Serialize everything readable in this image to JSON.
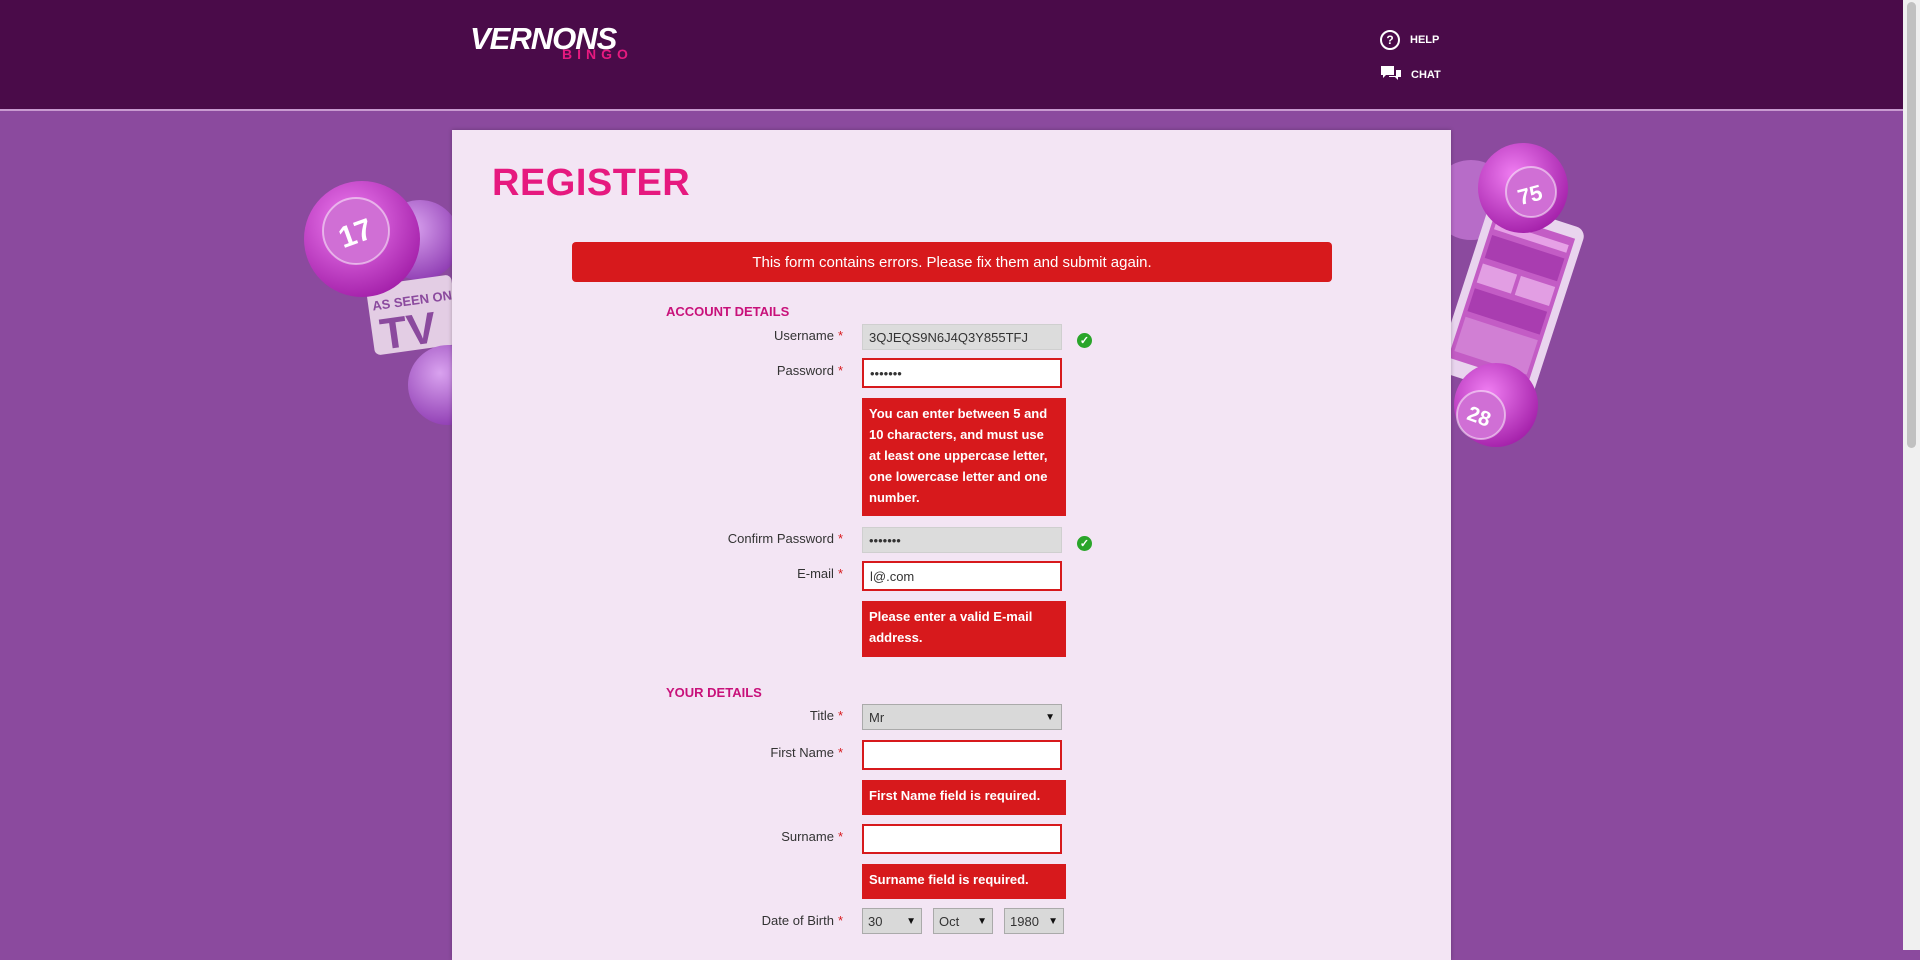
{
  "header": {
    "logo_main": "VERNONS",
    "logo_sub": "BINGO",
    "help_label": "HELP",
    "chat_label": "CHAT"
  },
  "decor": {
    "ball_left": "17",
    "tv_badge_line1": "AS SEEN ON",
    "tv_badge_line2": "TV",
    "ball_right_top": "75",
    "ball_right_bottom": "28"
  },
  "page": {
    "title": "REGISTER",
    "form_error": "This form contains errors. Please fix them and submit again."
  },
  "account": {
    "heading": "ACCOUNT DETAILS",
    "username": {
      "label": "Username",
      "value": "3QJEQS9N6J4Q3Y855TFJ"
    },
    "password": {
      "label": "Password",
      "value": "•••••••",
      "error": "You can enter between 5 and 10 characters, and must use at least one uppercase letter, one lowercase letter and one number."
    },
    "confirm_password": {
      "label": "Confirm Password",
      "value": "•••••••"
    },
    "email": {
      "label": "E-mail",
      "value": "l@.com",
      "error": "Please enter a valid E-mail address."
    }
  },
  "details": {
    "heading": "YOUR DETAILS",
    "title": {
      "label": "Title",
      "value": "Mr"
    },
    "first_name": {
      "label": "First Name",
      "value": "",
      "error": "First Name field is required."
    },
    "surname": {
      "label": "Surname",
      "value": "",
      "error": "Surname field is required."
    },
    "dob": {
      "label": "Date of Birth",
      "day": "30",
      "month": "Oct",
      "year": "1980"
    }
  },
  "required_mark": "*",
  "colors": {
    "header_bg": "#4a0b49",
    "page_bg": "#8b4a9e",
    "accent_pink": "#e6197f",
    "error_red": "#d7191c",
    "valid_green": "#2aa52a",
    "panel_bg": "#f3e5f4"
  }
}
